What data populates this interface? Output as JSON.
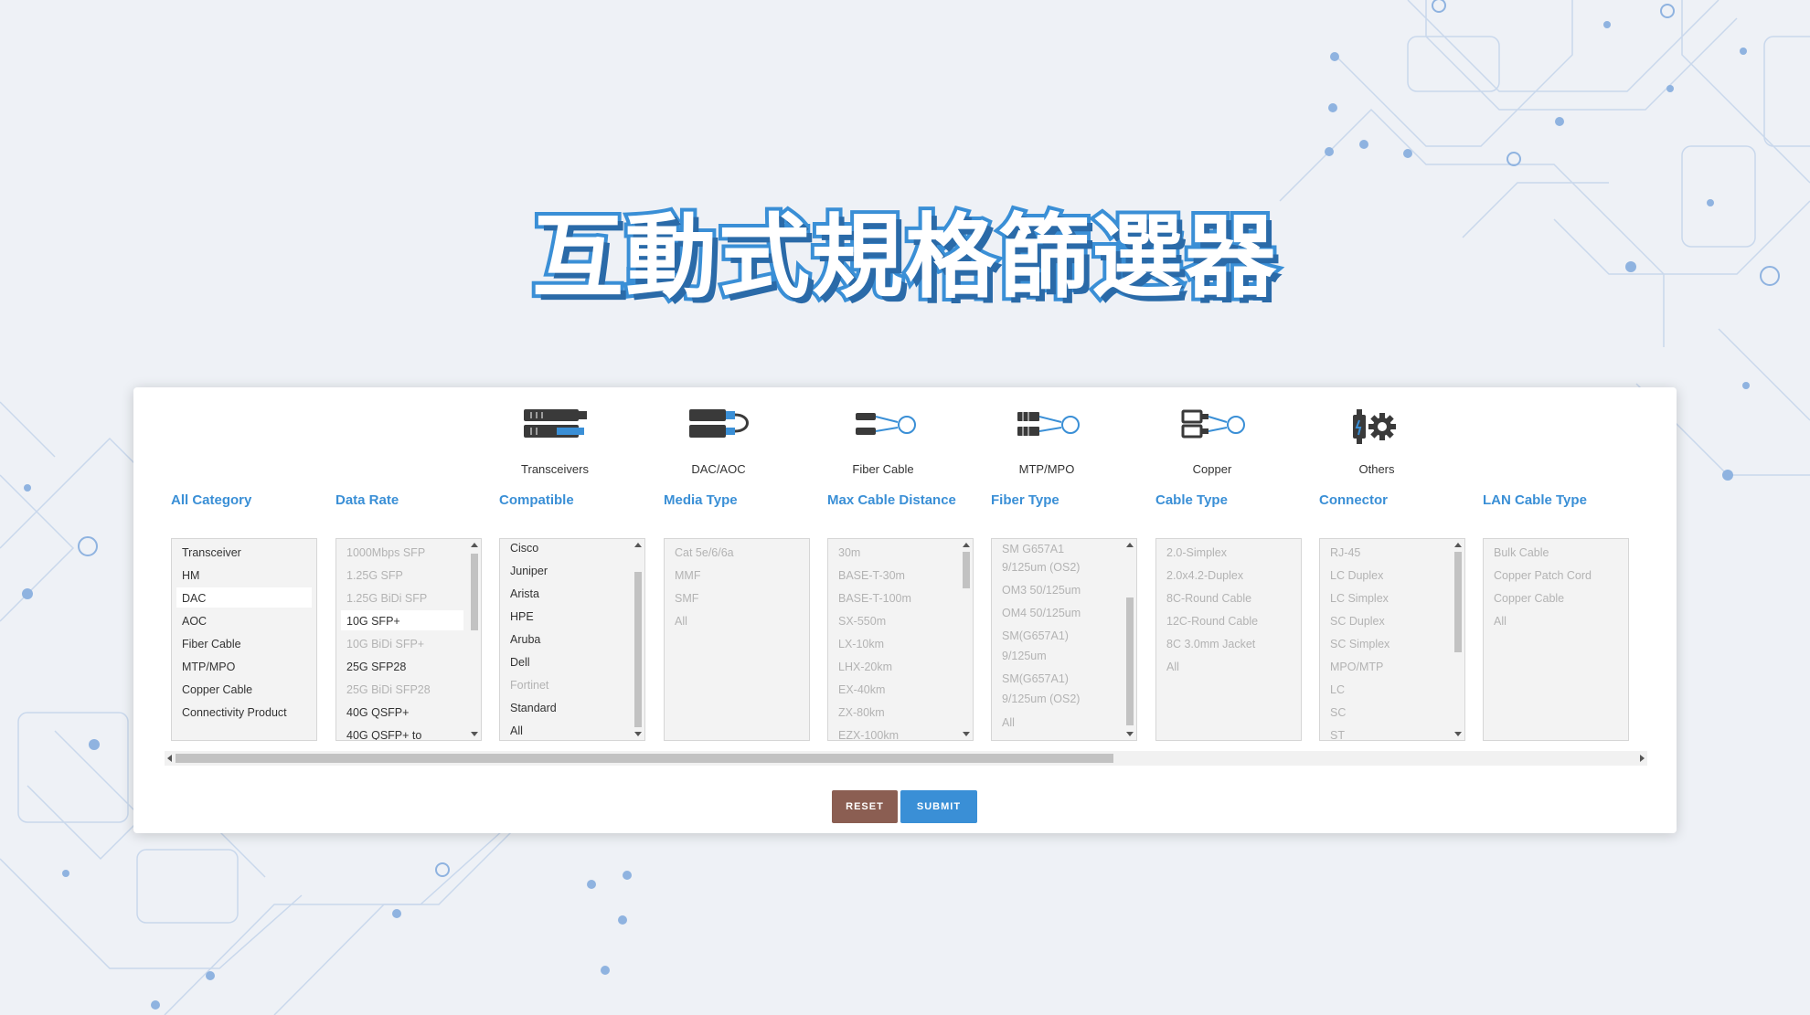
{
  "page": {
    "title": "互動式規格篩選器"
  },
  "colors": {
    "accent": "#3a8fd6",
    "reset": "#8b5e52",
    "background": "#eef1f6"
  },
  "categories": [
    {
      "label": "Transceivers",
      "icon": "transceiver-icon"
    },
    {
      "label": "DAC/AOC",
      "icon": "dac-aoc-icon"
    },
    {
      "label": "Fiber Cable",
      "icon": "fiber-cable-icon"
    },
    {
      "label": "MTP/MPO",
      "icon": "mtp-mpo-icon"
    },
    {
      "label": "Copper",
      "icon": "copper-icon"
    },
    {
      "label": "Others",
      "icon": "others-gear-icon"
    }
  ],
  "columns": [
    {
      "header": "All Category",
      "selected": 3,
      "options": [
        {
          "label": "Transceiver",
          "dim": false
        },
        {
          "label": "HM",
          "dim": false
        },
        {
          "label": "DAC",
          "dim": false
        },
        {
          "label": "AOC",
          "dim": false
        },
        {
          "label": "Fiber Cable",
          "dim": false
        },
        {
          "label": "MTP/MPO",
          "dim": false
        },
        {
          "label": "Copper Cable",
          "dim": false
        },
        {
          "label": "Connectivity Product",
          "dim": false
        }
      ]
    },
    {
      "header": "Data Rate",
      "selected": 4,
      "options": [
        {
          "label": "1000Mbps SFP",
          "dim": true
        },
        {
          "label": "1.25G SFP",
          "dim": true
        },
        {
          "label": "1.25G BiDi SFP",
          "dim": true
        },
        {
          "label": "10G SFP+",
          "dim": false
        },
        {
          "label": "10G BiDi SFP+",
          "dim": true
        },
        {
          "label": "25G SFP28",
          "dim": false
        },
        {
          "label": "25G BiDi SFP28",
          "dim": true
        },
        {
          "label": "40G QSFP+",
          "dim": false
        },
        {
          "label": "40G QSFP+ to",
          "dim": false
        }
      ]
    },
    {
      "header": "Compatible",
      "selected": 0,
      "options": [
        {
          "label": "Cisco",
          "dim": false
        },
        {
          "label": "Juniper",
          "dim": false
        },
        {
          "label": "Arista",
          "dim": false
        },
        {
          "label": "HPE",
          "dim": false
        },
        {
          "label": "Aruba",
          "dim": false
        },
        {
          "label": "Dell",
          "dim": false
        },
        {
          "label": "Fortinet",
          "dim": true
        },
        {
          "label": "Standard",
          "dim": false
        },
        {
          "label": "All",
          "dim": false
        }
      ]
    },
    {
      "header": "Media Type",
      "selected": 0,
      "options": [
        {
          "label": "Cat 5e/6/6a",
          "dim": true
        },
        {
          "label": "MMF",
          "dim": true
        },
        {
          "label": "SMF",
          "dim": true
        },
        {
          "label": "All",
          "dim": true
        }
      ]
    },
    {
      "header": "Max Cable Distance",
      "selected": 0,
      "options": [
        {
          "label": "30m",
          "dim": true
        },
        {
          "label": "BASE-T-30m",
          "dim": true
        },
        {
          "label": "BASE-T-100m",
          "dim": true
        },
        {
          "label": "SX-550m",
          "dim": true
        },
        {
          "label": "LX-10km",
          "dim": true
        },
        {
          "label": "LHX-20km",
          "dim": true
        },
        {
          "label": "EX-40km",
          "dim": true
        },
        {
          "label": "ZX-80km",
          "dim": true
        },
        {
          "label": "EZX-100km",
          "dim": true
        }
      ]
    },
    {
      "header": "Fiber Type",
      "selected": 0,
      "options": [
        {
          "label": "SM G657A1",
          "dim": true
        },
        {
          "label": "9/125um (OS2)",
          "dim": true
        },
        {
          "label": "OM3 50/125um",
          "dim": true
        },
        {
          "label": "OM4 50/125um",
          "dim": true
        },
        {
          "label": "SM(G657A1)",
          "dim": true
        },
        {
          "label": "9/125um",
          "dim": true
        },
        {
          "label": "SM(G657A1)",
          "dim": true
        },
        {
          "label": "9/125um (OS2)",
          "dim": true
        },
        {
          "label": "All",
          "dim": true
        }
      ]
    },
    {
      "header": "Cable Type",
      "selected": 0,
      "options": [
        {
          "label": "2.0-Simplex",
          "dim": true
        },
        {
          "label": "2.0x4.2-Duplex",
          "dim": true
        },
        {
          "label": "8C-Round Cable",
          "dim": true
        },
        {
          "label": "12C-Round Cable",
          "dim": true
        },
        {
          "label": "8C 3.0mm Jacket",
          "dim": true
        },
        {
          "label": "All",
          "dim": true
        }
      ]
    },
    {
      "header": "Connector",
      "selected": 0,
      "options": [
        {
          "label": "RJ-45",
          "dim": true
        },
        {
          "label": "LC Duplex",
          "dim": true
        },
        {
          "label": "LC Simplex",
          "dim": true
        },
        {
          "label": "SC Duplex",
          "dim": true
        },
        {
          "label": "SC Simplex",
          "dim": true
        },
        {
          "label": "MPO/MTP",
          "dim": true
        },
        {
          "label": "LC",
          "dim": true
        },
        {
          "label": "SC",
          "dim": true
        },
        {
          "label": "ST",
          "dim": true
        }
      ]
    },
    {
      "header": "LAN Cable Type",
      "selected": 0,
      "options": [
        {
          "label": "Bulk Cable",
          "dim": true
        },
        {
          "label": "Copper Patch Cord",
          "dim": true
        },
        {
          "label": "Copper Cable",
          "dim": true
        },
        {
          "label": "All",
          "dim": true
        }
      ]
    }
  ],
  "buttons": {
    "reset": "RESET",
    "submit": "SUBMIT"
  }
}
